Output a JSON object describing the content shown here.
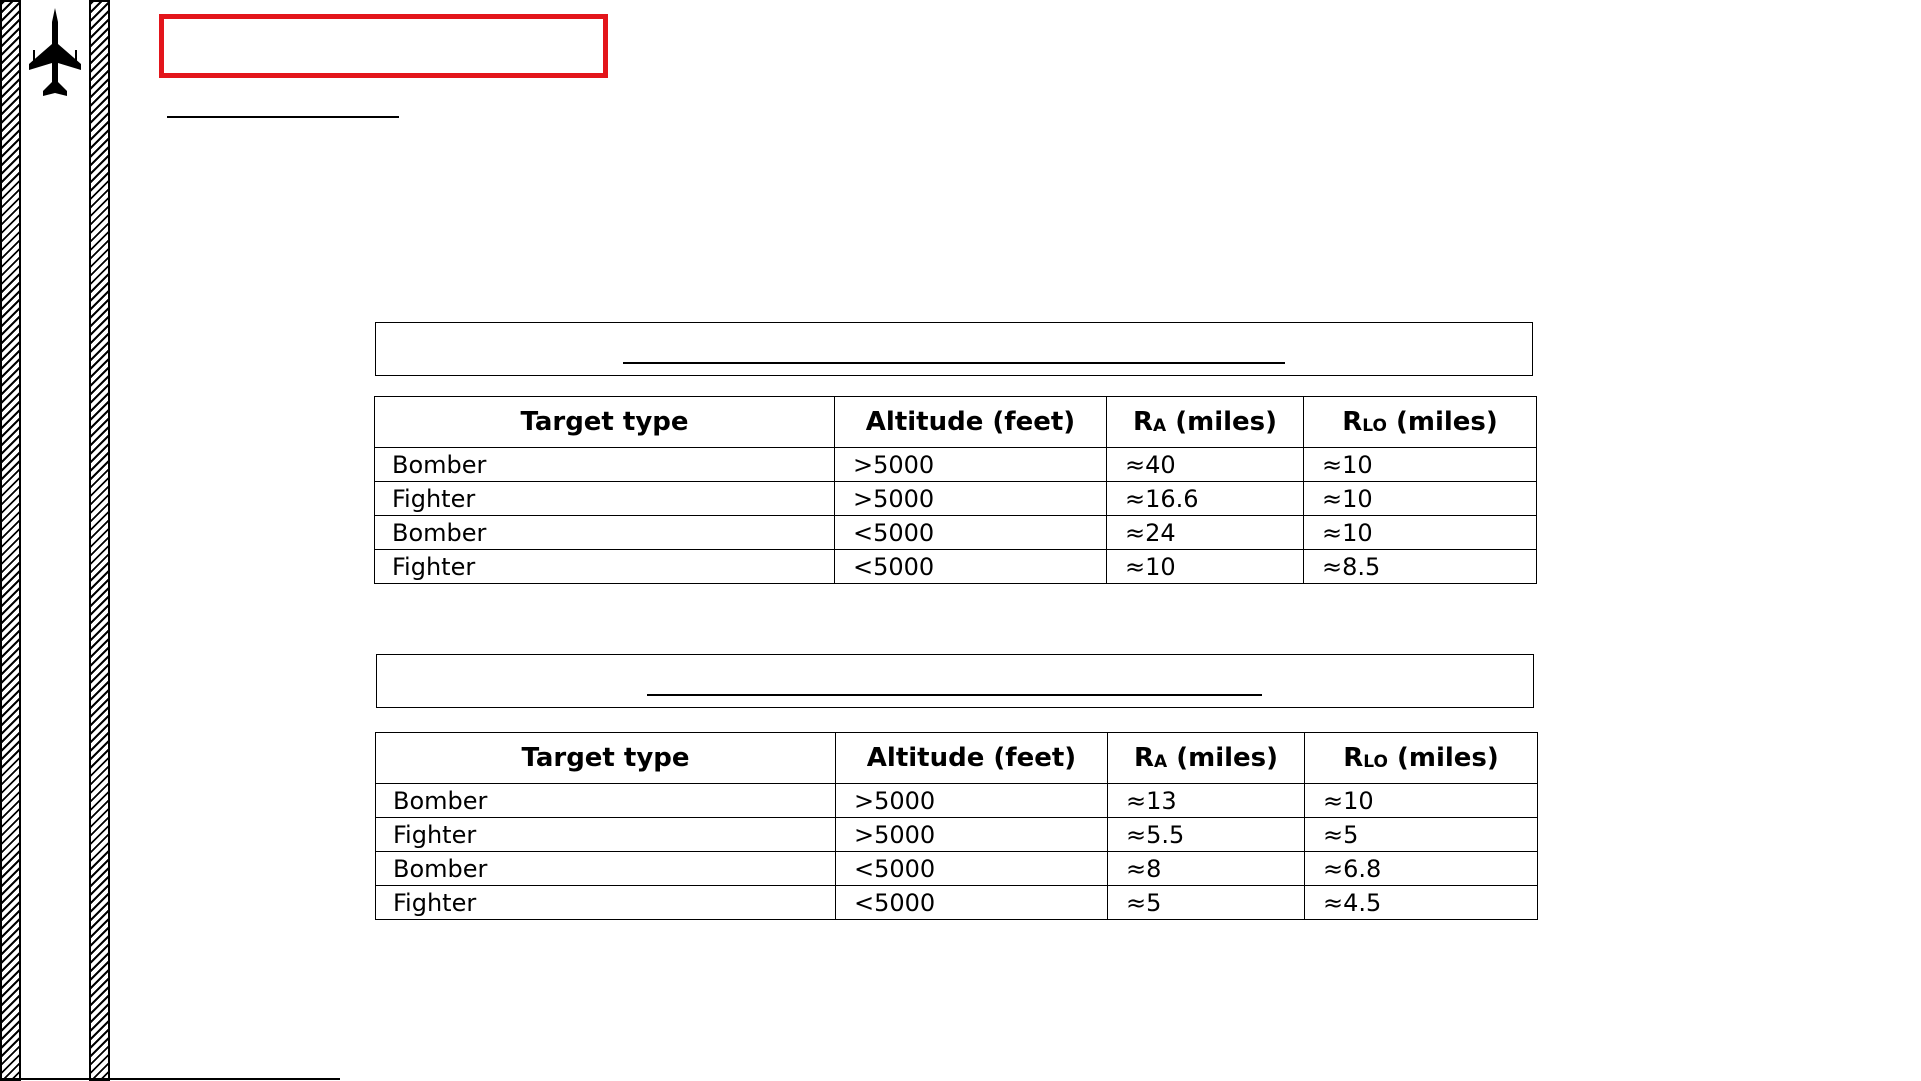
{
  "tables": [
    {
      "headers": {
        "target_type": "Target type",
        "altitude": "Altitude (feet)",
        "ra": {
          "main": "R",
          "sub": "A",
          "rest": " (miles)"
        },
        "rlo": {
          "main": "R",
          "sub": "LO",
          "rest": " (miles)"
        }
      },
      "rows": [
        {
          "target": "Bomber",
          "altitude": ">5000",
          "ra": "≈40",
          "rlo": "≈10"
        },
        {
          "target": "Fighter",
          "altitude": ">5000",
          "ra": "≈16.6",
          "rlo": "≈10"
        },
        {
          "target": "Bomber",
          "altitude": "<5000",
          "ra": "≈24",
          "rlo": "≈10"
        },
        {
          "target": "Fighter",
          "altitude": "<5000",
          "ra": "≈10",
          "rlo": "≈8.5"
        }
      ]
    },
    {
      "headers": {
        "target_type": "Target type",
        "altitude": "Altitude (feet)",
        "ra": {
          "main": "R",
          "sub": "A",
          "rest": " (miles)"
        },
        "rlo": {
          "main": "R",
          "sub": "LO",
          "rest": " (miles)"
        }
      },
      "rows": [
        {
          "target": "Bomber",
          "altitude": ">5000",
          "ra": "≈13",
          "rlo": "≈10"
        },
        {
          "target": "Fighter",
          "altitude": ">5000",
          "ra": "≈5.5",
          "rlo": "≈5"
        },
        {
          "target": "Bomber",
          "altitude": "<5000",
          "ra": "≈8",
          "rlo": "≈6.8"
        },
        {
          "target": "Fighter",
          "altitude": "<5000",
          "ra": "≈5",
          "rlo": "≈4.5"
        }
      ]
    }
  ],
  "icons": {
    "sidebar": "fighter-jet-icon"
  },
  "colors": {
    "title_box_border": "#e3151b"
  }
}
